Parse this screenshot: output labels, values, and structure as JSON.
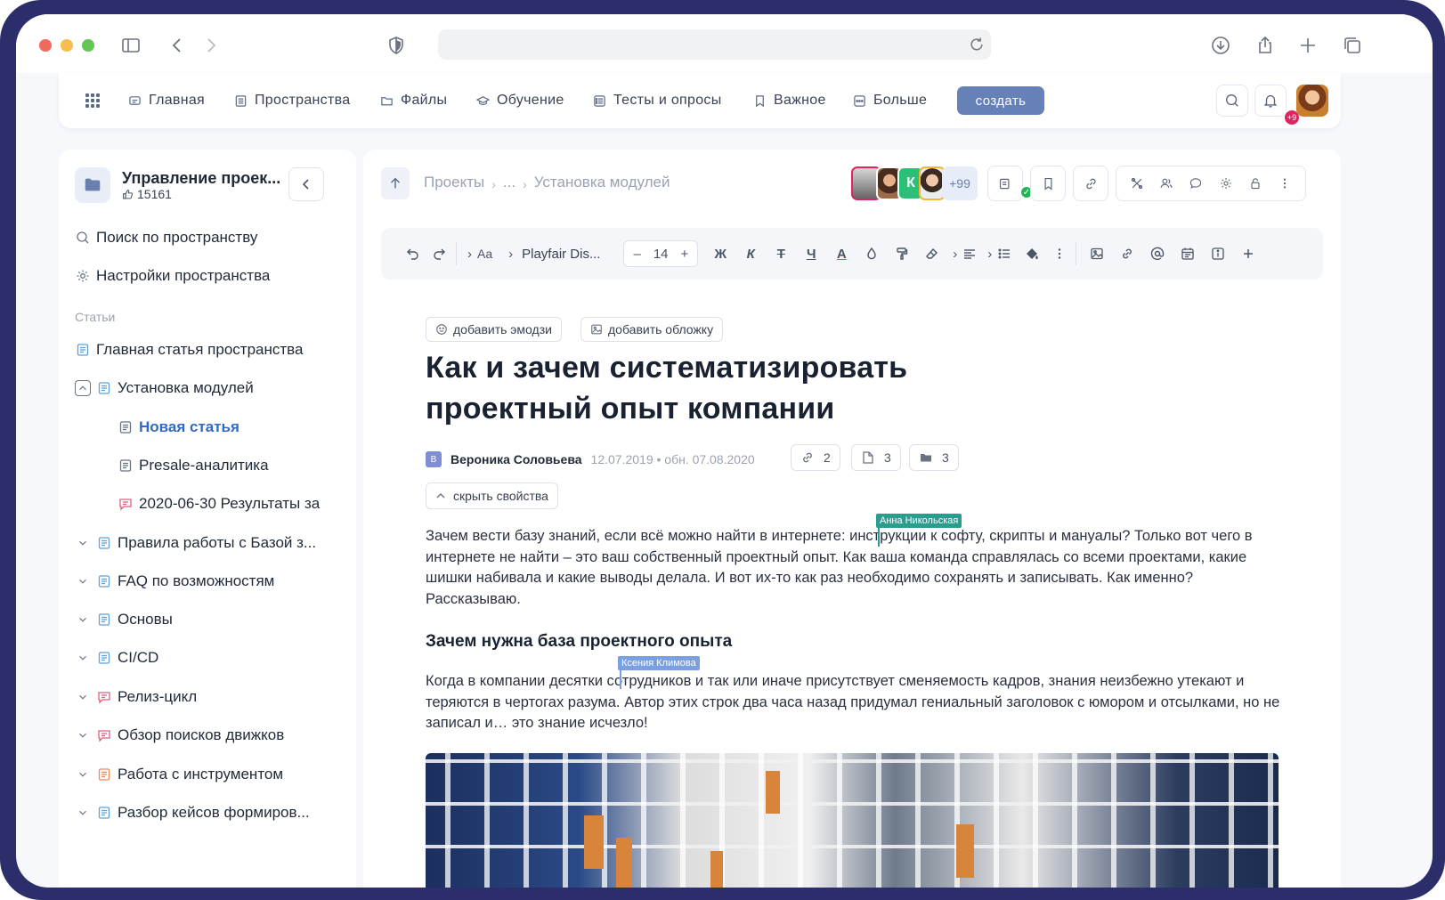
{
  "nav": {
    "items": [
      {
        "label": "Главная",
        "icon": "home-icon"
      },
      {
        "label": "Пространства",
        "icon": "spaces-icon"
      },
      {
        "label": "Файлы",
        "icon": "folder-icon"
      },
      {
        "label": "Обучение",
        "icon": "graduation-icon"
      },
      {
        "label": "Тесты и опросы",
        "icon": "survey-icon"
      },
      {
        "label": "Важное",
        "icon": "bookmark-icon"
      },
      {
        "label": "Больше",
        "icon": "more-icon"
      }
    ],
    "create_label": "создать",
    "notifications_badge": "+9"
  },
  "sidebar": {
    "space_title": "Управление проек...",
    "space_likes": "15161",
    "search_label": "Поиск по пространству",
    "settings_label": "Настройки пространства",
    "section_label": "Статьи",
    "items": [
      {
        "label": "Главная статья пространства"
      },
      {
        "label": "Установка модулей"
      },
      {
        "label": "Новая статья"
      },
      {
        "label": "Presale-аналитика"
      },
      {
        "label": "2020-06-30 Результаты за"
      },
      {
        "label": "Правила работы с Базой з..."
      },
      {
        "label": "FAQ по возможностям"
      },
      {
        "label": "Основы"
      },
      {
        "label": "CI/CD"
      },
      {
        "label": "Релиз-цикл"
      },
      {
        "label": "Обзор поисков движков"
      },
      {
        "label": "Работа с инструментом"
      },
      {
        "label": "Разбор кейсов формиров..."
      }
    ]
  },
  "header": {
    "breadcrumbs": [
      "Проекты",
      "...",
      "Установка модулей"
    ],
    "avatar_letter": "К",
    "participants_more": "+99"
  },
  "editor": {
    "font_name": "Playfair Dis...",
    "font_size": "14",
    "minus": "–",
    "plus": "+",
    "bold": "Ж",
    "italic": "К",
    "strike": "Т",
    "underline": "Ч",
    "text_color": "A",
    "text_style": "Aa"
  },
  "article": {
    "add_emoji": "добавить эмодзи",
    "add_cover": "добавить обложку",
    "title": "Как и зачем систематизировать проектный опыт компании",
    "author_initial": "В",
    "author": "Вероника Соловьева",
    "dates": "12.07.2019 • обн. 07.08.2020",
    "links_count": "2",
    "files_count": "3",
    "folders_count": "3",
    "hide_props": "скрыть свойства",
    "para1": "Зачем вести базу знаний, если всё можно найти в интернете: инструкции к софту, скрипты и мануалы? Только вот чего в интернете не найти – это ваш собственный проектный опыт. Как ваша команда справлялась со всеми проектами, какие шишки набивала и какие выводы делала. И вот их-то как раз необходимо сохранять и записывать. Как именно? Рассказываю.",
    "h2": "Зачем нужна база проектного опыта",
    "para2": "Когда в компании десятки сотрудников и так или иначе присутствует сменяемость кадров, знания неизбежно утекают и теряются в чертогах разума. Автор этих строк два часа назад придумал гениальный заголовок с юмором и отсылками, но не записал и… это знание исчезло!",
    "cursor1": "Анна Никольская",
    "cursor2": "Ксения Климова"
  },
  "colors": {
    "accent": "#6680b8",
    "active_link": "#2f6bc4",
    "cursor1": "#2a9d8f",
    "cursor2": "#7aa0e0",
    "frame": "#2b2e6b"
  }
}
